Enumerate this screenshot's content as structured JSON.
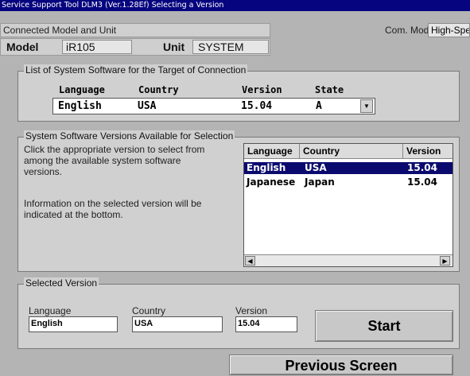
{
  "window": {
    "title": "Service Support Tool DLM3 (Ver.1.28Ef) Selecting a Version"
  },
  "connection": {
    "header": "Connected Model and Unit",
    "model_label": "Model",
    "model_value": "iR105",
    "unit_label": "Unit",
    "unit_value": "SYSTEM",
    "com_mode_label": "Com. Mode",
    "com_mode_value": "High-Spe"
  },
  "target_list": {
    "legend": "List of System Software for the Target of Connection",
    "headers": {
      "language": "Language",
      "country": "Country",
      "version": "Version",
      "state": "State"
    },
    "row": {
      "language": "English",
      "country": "USA",
      "version": "15.04",
      "state": "A"
    },
    "dropdown_icon": "triangle-down-icon"
  },
  "available": {
    "legend": "System Software Versions Available for Selection",
    "instructions_1": "Click the appropriate version to select from among the available system software versions.",
    "instructions_2": "Information on the selected version will be indicated at the bottom.",
    "columns": {
      "language": "Language",
      "country": "Country",
      "version": "Version"
    },
    "rows": [
      {
        "language": "English",
        "country": "USA",
        "version": "15.04",
        "selected": true
      },
      {
        "language": "Japanese",
        "country": "Japan",
        "version": "15.04",
        "selected": false
      }
    ],
    "scroll_left_icon": "triangle-left-icon",
    "scroll_right_icon": "triangle-right-icon"
  },
  "selected": {
    "legend": "Selected Version",
    "language_label": "Language",
    "language_value": "English",
    "country_label": "Country",
    "country_value": "USA",
    "version_label": "Version",
    "version_value": "15.04",
    "start_label": "Start"
  },
  "footer": {
    "previous_label": "Previous Screen"
  }
}
